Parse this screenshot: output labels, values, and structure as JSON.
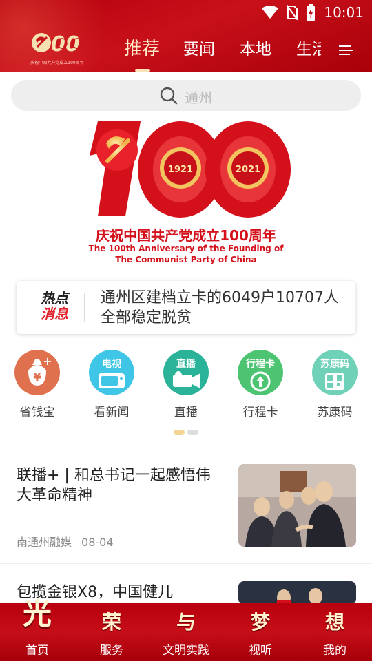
{
  "status_bar": {
    "time": "10:01"
  },
  "header": {
    "logo_caption": "庆祝中国共产党成立100周年",
    "tabs": [
      {
        "label": "推荐",
        "active": true
      },
      {
        "label": "要闻",
        "active": false
      },
      {
        "label": "本地",
        "active": false
      },
      {
        "label": "生活",
        "active": false
      }
    ]
  },
  "search": {
    "placeholder": "通州"
  },
  "banner": {
    "year_left": "1921",
    "year_right": "2021",
    "title_cn": "庆祝中国共产党成立100周年",
    "title_en_1": "The 100th Anniversary of the Founding of",
    "title_en_2": "The Communist Party of China"
  },
  "hot_news": {
    "badge_line1": "热点",
    "badge_line2": "消息",
    "text": "通州区建档立卡的6049户10707人全部稳定脱贫"
  },
  "quick_icons": [
    {
      "label": "省钱宝",
      "icon": "money-bag-icon",
      "color": "#e0714f",
      "glyph": "¥"
    },
    {
      "label": "看新闻",
      "icon": "tv-icon",
      "color": "#3fc6e6",
      "glyph": "电视"
    },
    {
      "label": "直播",
      "icon": "camera-icon",
      "color": "#2bb39a",
      "glyph": "直播"
    },
    {
      "label": "行程卡",
      "icon": "itinerary-icon",
      "color": "#4cc472",
      "glyph": "行程卡"
    },
    {
      "label": "苏康码",
      "icon": "qr-code-icon",
      "color": "#6fd1b7",
      "glyph": "苏康码"
    }
  ],
  "feed": [
    {
      "title": "联播+ | 和总书记一起感悟伟大革命精神",
      "source": "南通州融媒",
      "date": "08-04"
    },
    {
      "title": "包揽金银X8，中国健儿",
      "source": "",
      "date": ""
    }
  ],
  "bottom_nav": [
    {
      "label": "首页",
      "glyph": "光"
    },
    {
      "label": "服务",
      "glyph": "荣"
    },
    {
      "label": "文明实践",
      "glyph": "与"
    },
    {
      "label": "视听",
      "glyph": "梦"
    },
    {
      "label": "我的",
      "glyph": "想"
    }
  ],
  "colors": {
    "brand_red": "#c8101a",
    "tab_active": "#ffe9c8",
    "hot_red": "#e0222c"
  }
}
